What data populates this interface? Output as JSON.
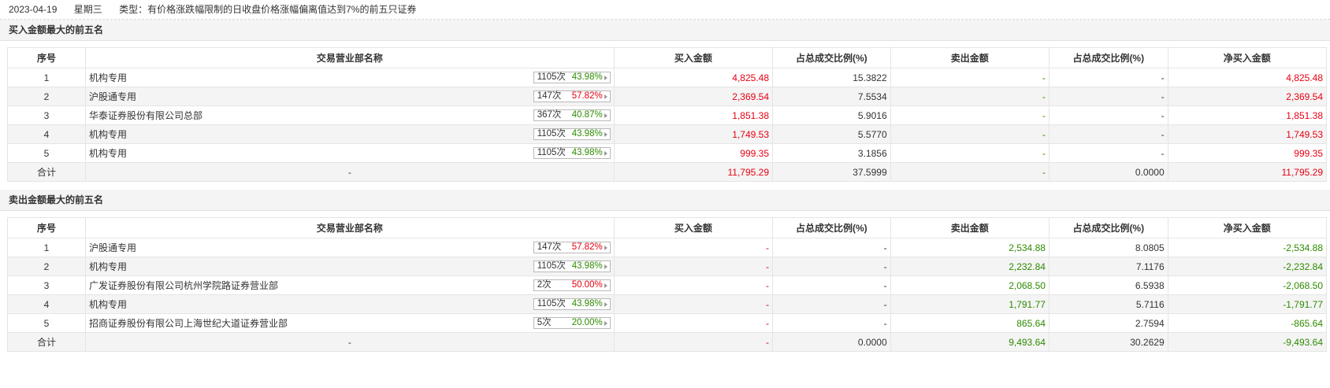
{
  "header": {
    "date": "2023-04-19",
    "weekday": "星期三",
    "type_text": "类型：有价格涨跌幅限制的日收盘价格涨幅偏离值达到7%的前五只证券"
  },
  "colors": {
    "up": "#e60012",
    "down": "#2e8b00"
  },
  "columns": [
    "序号",
    "交易营业部名称",
    "买入金额",
    "占总成交比例(%)",
    "卖出金额",
    "占总成交比例(%)",
    "净买入金额"
  ],
  "buy": {
    "title": "买入金额最大的前五名",
    "rows": [
      {
        "idx": "1",
        "name": "机构专用",
        "count": "1105次",
        "rate": "43.98%",
        "rate_color": "green",
        "buy": "4,825.48",
        "buy_pct": "15.3822",
        "sell": "-",
        "sell_pct": "-",
        "net": "4,825.48"
      },
      {
        "idx": "2",
        "name": "沪股通专用",
        "count": "147次",
        "rate": "57.82%",
        "rate_color": "red",
        "buy": "2,369.54",
        "buy_pct": "7.5534",
        "sell": "-",
        "sell_pct": "-",
        "net": "2,369.54"
      },
      {
        "idx": "3",
        "name": "华泰证券股份有限公司总部",
        "count": "367次",
        "rate": "40.87%",
        "rate_color": "green",
        "buy": "1,851.38",
        "buy_pct": "5.9016",
        "sell": "-",
        "sell_pct": "-",
        "net": "1,851.38"
      },
      {
        "idx": "4",
        "name": "机构专用",
        "count": "1105次",
        "rate": "43.98%",
        "rate_color": "green",
        "buy": "1,749.53",
        "buy_pct": "5.5770",
        "sell": "-",
        "sell_pct": "-",
        "net": "1,749.53"
      },
      {
        "idx": "5",
        "name": "机构专用",
        "count": "1105次",
        "rate": "43.98%",
        "rate_color": "green",
        "buy": "999.35",
        "buy_pct": "3.1856",
        "sell": "-",
        "sell_pct": "-",
        "net": "999.35"
      }
    ],
    "total": {
      "label": "合计",
      "name": "-",
      "buy": "11,795.29",
      "buy_pct": "37.5999",
      "sell": "-",
      "sell_pct": "0.0000",
      "net": "11,795.29"
    }
  },
  "sell": {
    "title": "卖出金额最大的前五名",
    "rows": [
      {
        "idx": "1",
        "name": "沪股通专用",
        "count": "147次",
        "rate": "57.82%",
        "rate_color": "red",
        "buy": "-",
        "buy_pct": "-",
        "sell": "2,534.88",
        "sell_pct": "8.0805",
        "net": "-2,534.88"
      },
      {
        "idx": "2",
        "name": "机构专用",
        "count": "1105次",
        "rate": "43.98%",
        "rate_color": "green",
        "buy": "-",
        "buy_pct": "-",
        "sell": "2,232.84",
        "sell_pct": "7.1176",
        "net": "-2,232.84"
      },
      {
        "idx": "3",
        "name": "广发证券股份有限公司杭州学院路证券营业部",
        "count": "2次",
        "rate": "50.00%",
        "rate_color": "red",
        "buy": "-",
        "buy_pct": "-",
        "sell": "2,068.50",
        "sell_pct": "6.5938",
        "net": "-2,068.50"
      },
      {
        "idx": "4",
        "name": "机构专用",
        "count": "1105次",
        "rate": "43.98%",
        "rate_color": "green",
        "buy": "-",
        "buy_pct": "-",
        "sell": "1,791.77",
        "sell_pct": "5.7116",
        "net": "-1,791.77"
      },
      {
        "idx": "5",
        "name": "招商证券股份有限公司上海世纪大道证券营业部",
        "count": "5次",
        "rate": "20.00%",
        "rate_color": "green",
        "buy": "-",
        "buy_pct": "-",
        "sell": "865.64",
        "sell_pct": "2.7594",
        "net": "-865.64"
      }
    ],
    "total": {
      "label": "合计",
      "name": "-",
      "buy": "-",
      "buy_pct": "0.0000",
      "sell": "9,493.64",
      "sell_pct": "30.2629",
      "net": "-9,493.64"
    }
  }
}
